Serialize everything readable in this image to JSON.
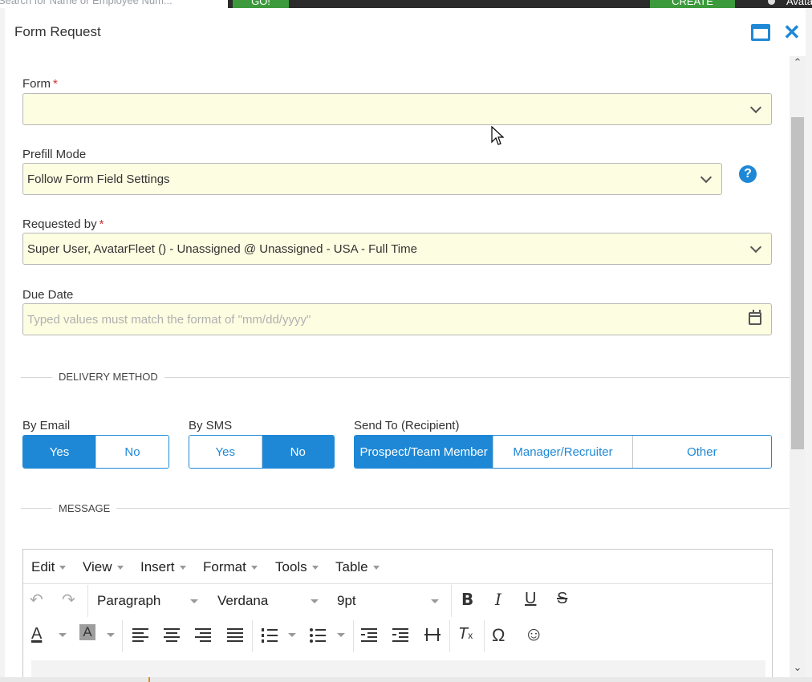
{
  "background": {
    "search_placeholder": "Search for Name or Employee Num...",
    "go_label": "GO!",
    "create_label": "CREATE",
    "user_label": "Avatar"
  },
  "modal": {
    "title": "Form Request",
    "maximize_icon": "maximize-icon",
    "close_icon": "close-icon"
  },
  "form_field": {
    "label": "Form",
    "required": "*",
    "value": ""
  },
  "prefill_mode": {
    "label": "Prefill Mode",
    "value": "Follow Form Field Settings",
    "help": "?"
  },
  "requested_by": {
    "label": "Requested by",
    "required": "*",
    "value": "Super User, AvatarFleet () - Unassigned @ Unassigned - USA - Full Time"
  },
  "due_date": {
    "label": "Due Date",
    "placeholder": "Typed values must match the format of \"mm/dd/yyyy\""
  },
  "delivery_method": {
    "section_title": "DELIVERY METHOD",
    "by_email": {
      "label": "By Email",
      "options": [
        "Yes",
        "No"
      ],
      "selected": "Yes"
    },
    "by_sms": {
      "label": "By SMS",
      "options": [
        "Yes",
        "No"
      ],
      "selected": "No"
    },
    "send_to": {
      "label": "Send To (Recipient)",
      "options": [
        "Prospect/Team Member",
        "Manager/Recruiter",
        "Other"
      ],
      "selected": "Prospect/Team Member"
    }
  },
  "message": {
    "section_title": "MESSAGE",
    "menus": [
      "Edit",
      "View",
      "Insert",
      "Format",
      "Tools",
      "Table"
    ],
    "block_format": "Paragraph",
    "font_family": "Verdana",
    "font_size": "9pt",
    "special_char": "Ω",
    "emoji": "☺"
  },
  "colors": {
    "accent": "#1e88d6",
    "field_bg": "#fdfde2",
    "required": "#d32f2f"
  }
}
